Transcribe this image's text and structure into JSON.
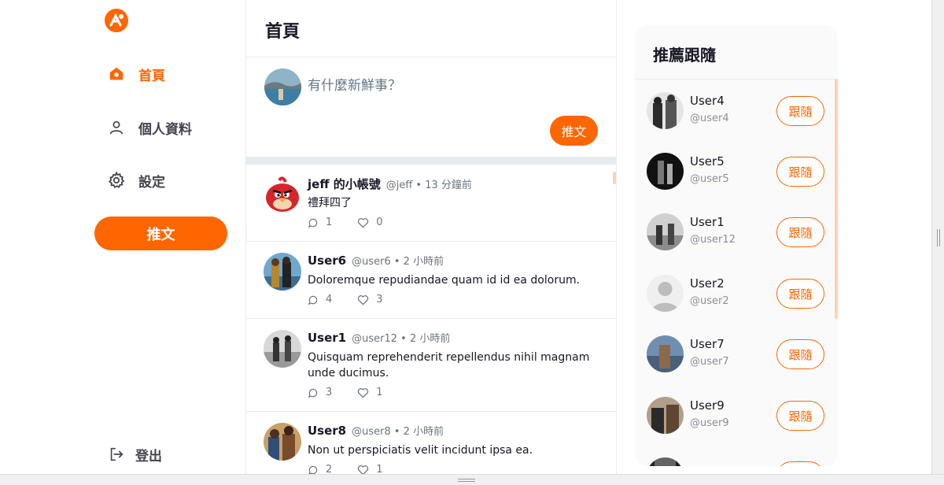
{
  "nav": {
    "home": "首頁",
    "profile": "個人資料",
    "settings": "設定",
    "tweet_button": "推文",
    "logout": "登出"
  },
  "main": {
    "title": "首頁",
    "composer_placeholder": "有什麼新鮮事？",
    "composer_submit": "推文"
  },
  "tweets": [
    {
      "name": "jeff 的小帳號",
      "meta": "@jeff • 13 分鐘前",
      "body": "禮拜四了",
      "replies": "1",
      "likes": "0"
    },
    {
      "name": "User6",
      "meta": "@user6 • 2 小時前",
      "body": "Doloremque repudiandae quam id id ea dolorum.",
      "replies": "4",
      "likes": "3"
    },
    {
      "name": "User1",
      "meta": "@user12 • 2 小時前",
      "body": "Quisquam reprehenderit repellendus nihil magnam unde ducimus.",
      "replies": "3",
      "likes": "1"
    },
    {
      "name": "User8",
      "meta": "@user8 • 2 小時前",
      "body": "Non ut perspiciatis velit incidunt ipsa ea.",
      "replies": "2",
      "likes": "1"
    }
  ],
  "suggest": {
    "title": "推薦跟隨",
    "follow_label": "跟隨",
    "users": [
      {
        "name": "User4",
        "handle": "@user4"
      },
      {
        "name": "User5",
        "handle": "@user5"
      },
      {
        "name": "User1",
        "handle": "@user12"
      },
      {
        "name": "User2",
        "handle": "@user2"
      },
      {
        "name": "User7",
        "handle": "@user7"
      },
      {
        "name": "User9",
        "handle": "@user9"
      }
    ]
  },
  "colors": {
    "brand": "#ff6600",
    "border": "#e6ecf0",
    "muted_text": "#6c757d",
    "panel_bg": "#fafafb"
  },
  "icons": {
    "logo": "ac-logo",
    "home": "home-icon",
    "profile": "user-icon",
    "settings": "gear-icon",
    "logout": "logout-icon",
    "reply": "comment-icon",
    "like": "heart-icon"
  }
}
